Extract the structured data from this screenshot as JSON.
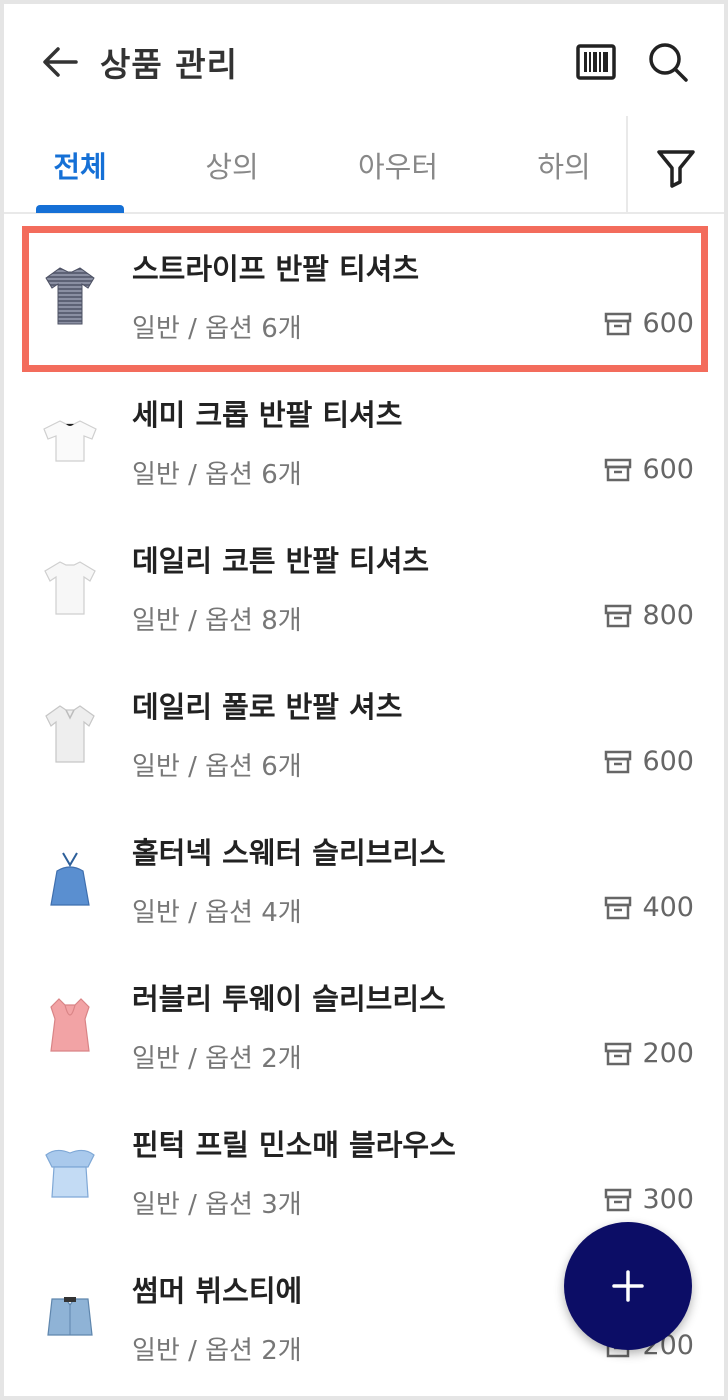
{
  "header": {
    "title": "상품 관리",
    "back_icon": "arrow-left-icon",
    "barcode_icon": "barcode-icon",
    "search_icon": "search-icon"
  },
  "tabs": [
    {
      "label": "전체",
      "active": true
    },
    {
      "label": "상의",
      "active": false
    },
    {
      "label": "아우터",
      "active": false
    },
    {
      "label": "하의",
      "active": false
    }
  ],
  "filter_icon": "filter-icon",
  "products": [
    {
      "name": "스트라이프 반팔 티셔츠",
      "meta": "일반 / 옵션 6개",
      "stock": "600",
      "selected": true
    },
    {
      "name": "세미 크롭 반팔 티셔츠",
      "meta": "일반 / 옵션 6개",
      "stock": "600"
    },
    {
      "name": "데일리 코튼 반팔 티셔츠",
      "meta": "일반 / 옵션 8개",
      "stock": "800"
    },
    {
      "name": "데일리 폴로 반팔 셔츠",
      "meta": "일반 / 옵션 6개",
      "stock": "600"
    },
    {
      "name": "홀터넥 스웨터 슬리브리스",
      "meta": "일반 / 옵션 4개",
      "stock": "400"
    },
    {
      "name": "러블리 투웨이 슬리브리스",
      "meta": "일반 / 옵션 2개",
      "stock": "200"
    },
    {
      "name": "핀턱 프릴 민소매 블라우스",
      "meta": "일반 / 옵션 3개",
      "stock": "300"
    },
    {
      "name": "썸머 뷔스티에",
      "meta": "일반 / 옵션 2개",
      "stock": "200"
    }
  ],
  "colors": {
    "accent": "#1570d6",
    "selection_border": "#f36c5c",
    "fab": "#0c0d66"
  },
  "fab_icon": "plus-icon"
}
